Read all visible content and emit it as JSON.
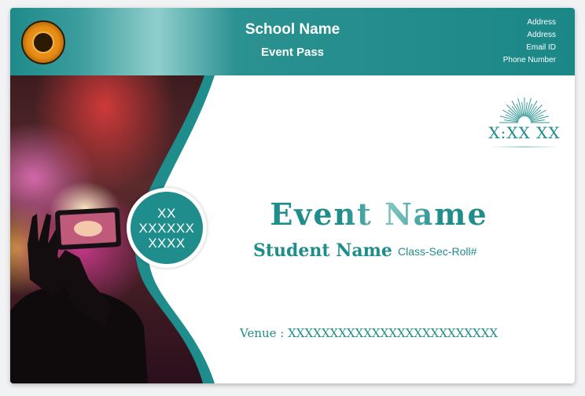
{
  "header": {
    "school_name": "School Name",
    "pass_title": "Event Pass",
    "contact": [
      "Address",
      "Address",
      "Email ID",
      "Phone Number"
    ]
  },
  "badge": [
    "XX",
    "XXXXXX",
    "XXXX"
  ],
  "time": "X:XX XX",
  "event_name": "Event Name",
  "student_name": "Student Name",
  "class_roll": "Class-Sec-Roll#",
  "venue": "Venue : XXXXXXXXXXXXXXXXXXXXXXXXX",
  "colors": {
    "accent": "#1e8d8c",
    "header": "#1b8787",
    "background": "#ffffff"
  },
  "icons": {
    "logo": "school-emblem-logo",
    "sunburst": "sunburst-icon"
  }
}
